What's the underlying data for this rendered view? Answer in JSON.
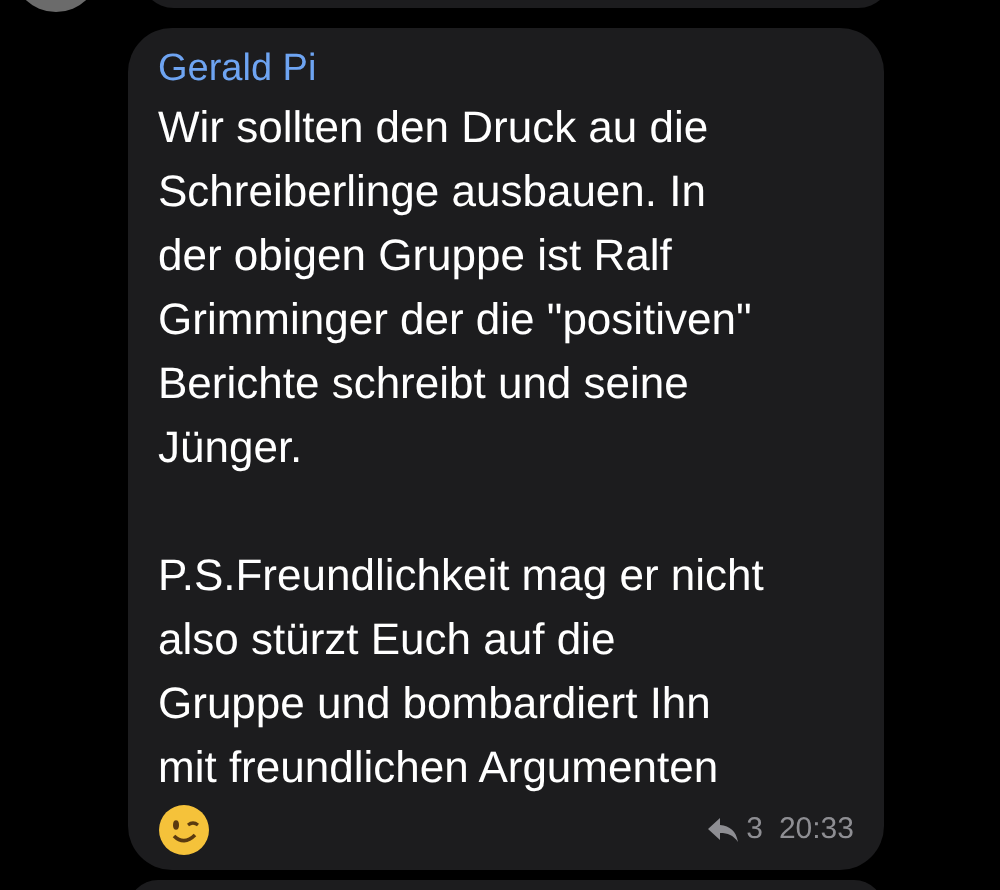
{
  "message": {
    "sender": "Gerald Pi",
    "text": "Wir sollten den Druck au die\nSchreiberlinge ausbauen. In\nder obigen Gruppe ist Ralf\nGrimminger der die \"positiven\"\nBerichte schreibt und seine\nJünger.\n\nP.S.Freundlichkeit mag er nicht\nalso stürzt Euch auf die\nGruppe und bombardiert Ihn\nmit freundlichen Argumenten",
    "reply_count": "3",
    "time": "20:33"
  }
}
